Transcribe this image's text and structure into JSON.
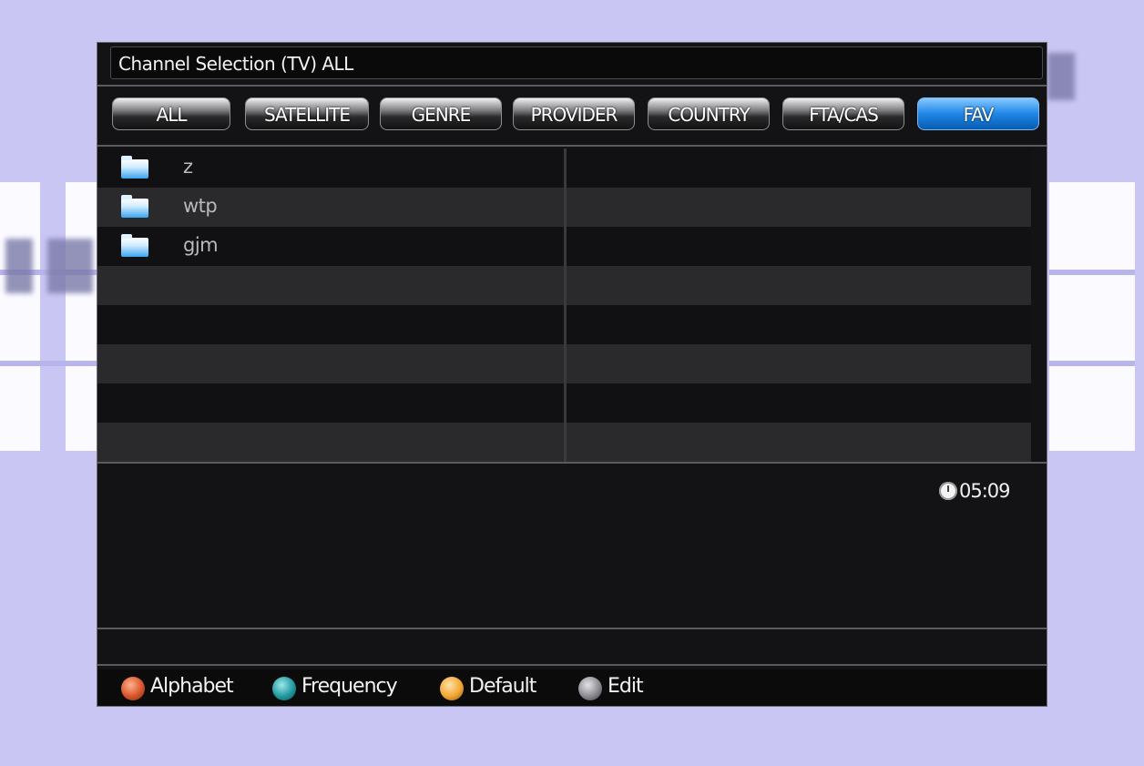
{
  "window": {
    "title": "Channel Selection (TV) ALL"
  },
  "tabs": [
    {
      "label": "ALL",
      "active": false
    },
    {
      "label": "SATELLITE",
      "active": false
    },
    {
      "label": "GENRE",
      "active": false
    },
    {
      "label": "PROVIDER",
      "active": false
    },
    {
      "label": "COUNTRY",
      "active": false
    },
    {
      "label": "FTA/CAS",
      "active": false
    },
    {
      "label": "FAV",
      "active": true
    }
  ],
  "list": {
    "items": [
      {
        "icon": "folder-icon",
        "label": "z"
      },
      {
        "icon": "folder-icon",
        "label": "wtp"
      },
      {
        "icon": "folder-icon",
        "label": "gjm"
      }
    ]
  },
  "status": {
    "time": "05:09"
  },
  "hints": [
    {
      "label": "Alphabet",
      "color": "#d9542a",
      "icon": "red-button-icon"
    },
    {
      "label": "Frequency",
      "color": "#1f9aa0",
      "icon": "green-button-icon"
    },
    {
      "label": "Default",
      "color": "#f2a632",
      "icon": "yellow-button-icon"
    },
    {
      "label": "Edit",
      "color": "#9a9aa0",
      "icon": "menu-button-icon"
    }
  ],
  "colors": {
    "accent": "#1f86e6",
    "panel": "#131315",
    "background": "#c9c6f4"
  }
}
